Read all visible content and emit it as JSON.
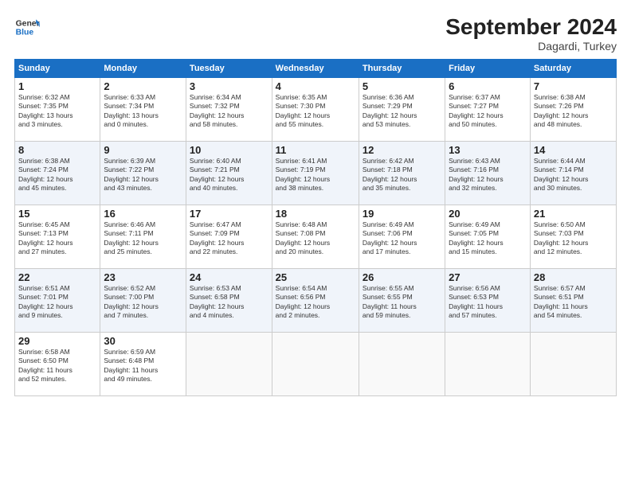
{
  "logo": {
    "line1": "General",
    "line2": "Blue"
  },
  "title": "September 2024",
  "subtitle": "Dagardi, Turkey",
  "days_header": [
    "Sunday",
    "Monday",
    "Tuesday",
    "Wednesday",
    "Thursday",
    "Friday",
    "Saturday"
  ],
  "weeks": [
    [
      {
        "day": "1",
        "info": "Sunrise: 6:32 AM\nSunset: 7:35 PM\nDaylight: 13 hours\nand 3 minutes."
      },
      {
        "day": "2",
        "info": "Sunrise: 6:33 AM\nSunset: 7:34 PM\nDaylight: 13 hours\nand 0 minutes."
      },
      {
        "day": "3",
        "info": "Sunrise: 6:34 AM\nSunset: 7:32 PM\nDaylight: 12 hours\nand 58 minutes."
      },
      {
        "day": "4",
        "info": "Sunrise: 6:35 AM\nSunset: 7:30 PM\nDaylight: 12 hours\nand 55 minutes."
      },
      {
        "day": "5",
        "info": "Sunrise: 6:36 AM\nSunset: 7:29 PM\nDaylight: 12 hours\nand 53 minutes."
      },
      {
        "day": "6",
        "info": "Sunrise: 6:37 AM\nSunset: 7:27 PM\nDaylight: 12 hours\nand 50 minutes."
      },
      {
        "day": "7",
        "info": "Sunrise: 6:38 AM\nSunset: 7:26 PM\nDaylight: 12 hours\nand 48 minutes."
      }
    ],
    [
      {
        "day": "8",
        "info": "Sunrise: 6:38 AM\nSunset: 7:24 PM\nDaylight: 12 hours\nand 45 minutes."
      },
      {
        "day": "9",
        "info": "Sunrise: 6:39 AM\nSunset: 7:22 PM\nDaylight: 12 hours\nand 43 minutes."
      },
      {
        "day": "10",
        "info": "Sunrise: 6:40 AM\nSunset: 7:21 PM\nDaylight: 12 hours\nand 40 minutes."
      },
      {
        "day": "11",
        "info": "Sunrise: 6:41 AM\nSunset: 7:19 PM\nDaylight: 12 hours\nand 38 minutes."
      },
      {
        "day": "12",
        "info": "Sunrise: 6:42 AM\nSunset: 7:18 PM\nDaylight: 12 hours\nand 35 minutes."
      },
      {
        "day": "13",
        "info": "Sunrise: 6:43 AM\nSunset: 7:16 PM\nDaylight: 12 hours\nand 32 minutes."
      },
      {
        "day": "14",
        "info": "Sunrise: 6:44 AM\nSunset: 7:14 PM\nDaylight: 12 hours\nand 30 minutes."
      }
    ],
    [
      {
        "day": "15",
        "info": "Sunrise: 6:45 AM\nSunset: 7:13 PM\nDaylight: 12 hours\nand 27 minutes."
      },
      {
        "day": "16",
        "info": "Sunrise: 6:46 AM\nSunset: 7:11 PM\nDaylight: 12 hours\nand 25 minutes."
      },
      {
        "day": "17",
        "info": "Sunrise: 6:47 AM\nSunset: 7:09 PM\nDaylight: 12 hours\nand 22 minutes."
      },
      {
        "day": "18",
        "info": "Sunrise: 6:48 AM\nSunset: 7:08 PM\nDaylight: 12 hours\nand 20 minutes."
      },
      {
        "day": "19",
        "info": "Sunrise: 6:49 AM\nSunset: 7:06 PM\nDaylight: 12 hours\nand 17 minutes."
      },
      {
        "day": "20",
        "info": "Sunrise: 6:49 AM\nSunset: 7:05 PM\nDaylight: 12 hours\nand 15 minutes."
      },
      {
        "day": "21",
        "info": "Sunrise: 6:50 AM\nSunset: 7:03 PM\nDaylight: 12 hours\nand 12 minutes."
      }
    ],
    [
      {
        "day": "22",
        "info": "Sunrise: 6:51 AM\nSunset: 7:01 PM\nDaylight: 12 hours\nand 9 minutes."
      },
      {
        "day": "23",
        "info": "Sunrise: 6:52 AM\nSunset: 7:00 PM\nDaylight: 12 hours\nand 7 minutes."
      },
      {
        "day": "24",
        "info": "Sunrise: 6:53 AM\nSunset: 6:58 PM\nDaylight: 12 hours\nand 4 minutes."
      },
      {
        "day": "25",
        "info": "Sunrise: 6:54 AM\nSunset: 6:56 PM\nDaylight: 12 hours\nand 2 minutes."
      },
      {
        "day": "26",
        "info": "Sunrise: 6:55 AM\nSunset: 6:55 PM\nDaylight: 11 hours\nand 59 minutes."
      },
      {
        "day": "27",
        "info": "Sunrise: 6:56 AM\nSunset: 6:53 PM\nDaylight: 11 hours\nand 57 minutes."
      },
      {
        "day": "28",
        "info": "Sunrise: 6:57 AM\nSunset: 6:51 PM\nDaylight: 11 hours\nand 54 minutes."
      }
    ],
    [
      {
        "day": "29",
        "info": "Sunrise: 6:58 AM\nSunset: 6:50 PM\nDaylight: 11 hours\nand 52 minutes."
      },
      {
        "day": "30",
        "info": "Sunrise: 6:59 AM\nSunset: 6:48 PM\nDaylight: 11 hours\nand 49 minutes."
      },
      {
        "day": "",
        "info": ""
      },
      {
        "day": "",
        "info": ""
      },
      {
        "day": "",
        "info": ""
      },
      {
        "day": "",
        "info": ""
      },
      {
        "day": "",
        "info": ""
      }
    ]
  ]
}
